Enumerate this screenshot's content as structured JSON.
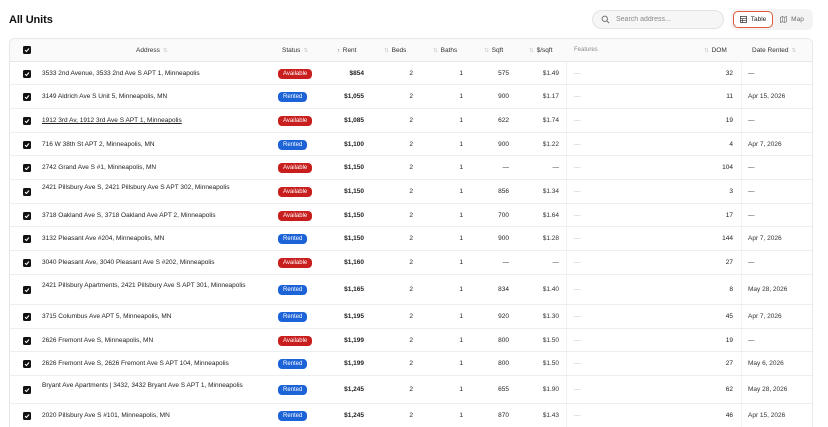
{
  "page": {
    "title": "All Units"
  },
  "search": {
    "placeholder": "Search address..."
  },
  "view_toggle": {
    "table_label": "Table",
    "map_label": "Map",
    "selected": "Table"
  },
  "table": {
    "headers": {
      "address": "Address",
      "status": "Status",
      "rent": "Rent",
      "beds": "Beds",
      "baths": "Baths",
      "sqft": "Sqft",
      "psf": "$/sqft",
      "features": "Features",
      "dom": "DOM",
      "date_rented": "Date Rented"
    },
    "rows": [
      {
        "address": "3533 2nd Avenue, 3533 2nd Ave S APT 1, Minneapolis",
        "status": "Available",
        "rent": "$854",
        "beds": "2",
        "baths": "1",
        "sqft": "575",
        "psf": "$1.49",
        "features": "—",
        "dom": "32",
        "date": "—"
      },
      {
        "address": "3149 Aldrich Ave S Unit 5, Minneapolis, MN",
        "status": "Rented",
        "rent": "$1,055",
        "beds": "2",
        "baths": "1",
        "sqft": "900",
        "psf": "$1.17",
        "features": "—",
        "dom": "11",
        "date": "Apr 15, 2026"
      },
      {
        "address": "1912 3rd Av, 1912 3rd Ave S APT 1, Minneapolis",
        "status": "Available",
        "rent": "$1,085",
        "beds": "2",
        "baths": "1",
        "sqft": "622",
        "psf": "$1.74",
        "features": "—",
        "dom": "19",
        "date": "—"
      },
      {
        "address": "716 W 38th St APT 2, Minneapolis, MN",
        "status": "Rented",
        "rent": "$1,100",
        "beds": "2",
        "baths": "1",
        "sqft": "900",
        "psf": "$1.22",
        "features": "—",
        "dom": "4",
        "date": "Apr 7, 2026"
      },
      {
        "address": "2742 Grand Ave S #1, Minneapolis, MN",
        "status": "Available",
        "rent": "$1,150",
        "beds": "2",
        "baths": "1",
        "sqft": "—",
        "psf": "—",
        "features": "—",
        "dom": "104",
        "date": "—"
      },
      {
        "address": "2421 Pillsbury Ave S, 2421 Pillsbury Ave S APT 302, Minneapolis",
        "status": "Available",
        "rent": "$1,150",
        "beds": "2",
        "baths": "1",
        "sqft": "856",
        "psf": "$1.34",
        "features": "—",
        "dom": "3",
        "date": "—"
      },
      {
        "address": "3718 Oakland Ave S, 3718 Oakland Ave APT 2, Minneapolis",
        "status": "Available",
        "rent": "$1,150",
        "beds": "2",
        "baths": "1",
        "sqft": "700",
        "psf": "$1.64",
        "features": "—",
        "dom": "17",
        "date": "—"
      },
      {
        "address": "3132 Pleasant Ave #204, Minneapolis, MN",
        "status": "Rented",
        "rent": "$1,150",
        "beds": "2",
        "baths": "1",
        "sqft": "900",
        "psf": "$1.28",
        "features": "—",
        "dom": "144",
        "date": "Apr 7, 2026"
      },
      {
        "address": "3040 Pleasant Ave, 3040 Pleasant Ave S #202, Minneapolis",
        "status": "Available",
        "rent": "$1,160",
        "beds": "2",
        "baths": "1",
        "sqft": "—",
        "psf": "—",
        "features": "—",
        "dom": "27",
        "date": "—"
      },
      {
        "address": "2421 Pillsbury Apartments, 2421 Pillsbury Ave S APT 301, Minneapolis",
        "status": "Rented",
        "rent": "$1,165",
        "beds": "2",
        "baths": "1",
        "sqft": "834",
        "psf": "$1.40",
        "features": "—",
        "dom": "8",
        "date": "May 28, 2026"
      },
      {
        "address": "3715 Columbus Ave APT 5, Minneapolis, MN",
        "status": "Rented",
        "rent": "$1,195",
        "beds": "2",
        "baths": "1",
        "sqft": "920",
        "psf": "$1.30",
        "features": "—",
        "dom": "45",
        "date": "Apr 7, 2026"
      },
      {
        "address": "2626 Fremont Ave S, Minneapolis, MN",
        "status": "Available",
        "rent": "$1,199",
        "beds": "2",
        "baths": "1",
        "sqft": "800",
        "psf": "$1.50",
        "features": "—",
        "dom": "19",
        "date": "—"
      },
      {
        "address": "2626 Fremont Ave S, 2626 Fremont Ave S APT 104, Minneapolis",
        "status": "Rented",
        "rent": "$1,199",
        "beds": "2",
        "baths": "1",
        "sqft": "800",
        "psf": "$1.50",
        "features": "—",
        "dom": "27",
        "date": "May 6, 2026"
      },
      {
        "address": "Bryant Ave Apartments | 3432, 3432 Bryant Ave S APT 1, Minneapolis",
        "status": "Rented",
        "rent": "$1,245",
        "beds": "2",
        "baths": "1",
        "sqft": "655",
        "psf": "$1.90",
        "features": "—",
        "dom": "62",
        "date": "May 28, 2026"
      },
      {
        "address": "2020 Pillsbury Ave S #101, Minneapolis, MN",
        "status": "Rented",
        "rent": "$1,245",
        "beds": "2",
        "baths": "1",
        "sqft": "870",
        "psf": "$1.43",
        "features": "—",
        "dom": "46",
        "date": "Apr 15, 2026"
      }
    ]
  },
  "colors": {
    "available": "#c81e1e",
    "rented": "#1d63d8",
    "toggle_accent": "#e05a3a"
  }
}
